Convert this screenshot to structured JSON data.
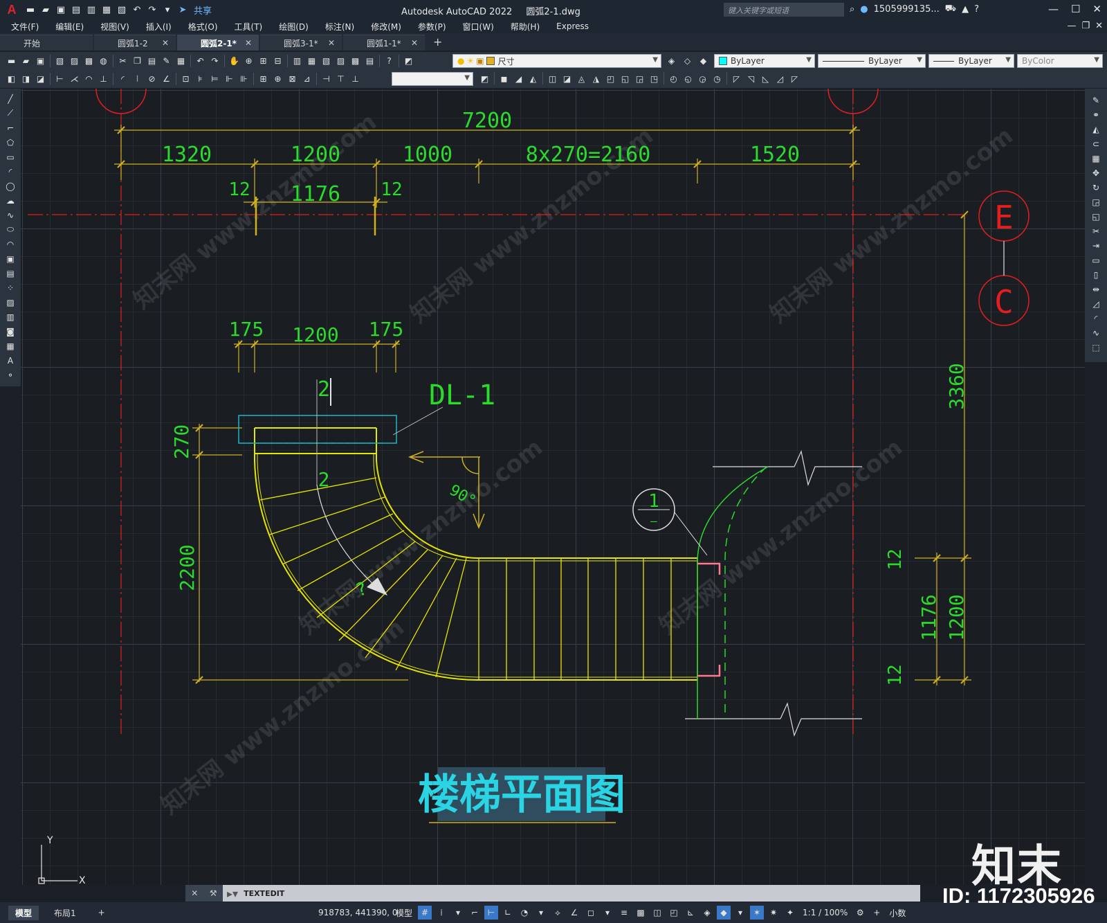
{
  "app": {
    "logo": "A",
    "title": "Autodesk AutoCAD 2022",
    "file": "圆弧2-1.dwg",
    "share": "共享",
    "search_placeholder": "键入关键字或短语",
    "user": "1505999135...",
    "help": "?"
  },
  "menu": [
    "文件(F)",
    "编辑(E)",
    "视图(V)",
    "插入(I)",
    "格式(O)",
    "工具(T)",
    "绘图(D)",
    "标注(N)",
    "修改(M)",
    "参数(P)",
    "窗口(W)",
    "帮助(H)",
    "Express"
  ],
  "tabs": [
    {
      "label": "开始",
      "active": false,
      "closable": false
    },
    {
      "label": "圆弧1-2",
      "active": false,
      "closable": true
    },
    {
      "label": "圆弧2-1*",
      "active": true,
      "closable": true
    },
    {
      "label": "圆弧3-1*",
      "active": false,
      "closable": true
    },
    {
      "label": "圆弧1-1*",
      "active": false,
      "closable": true
    }
  ],
  "properties": {
    "layer": "尺寸",
    "color": "ByLayer",
    "color_swatch": "#00ffff",
    "linetype": "ByLayer",
    "lineweight": "ByLayer",
    "plotstyle": "ByColor",
    "layer_swatch": "#e0b020"
  },
  "drawing": {
    "title": "楼梯平面图",
    "dims": {
      "total": "7200",
      "d1": "1320",
      "d2": "1200",
      "d3": "1000",
      "d4": "8x270=2160",
      "d5": "1520",
      "small_left": "12",
      "small_mid": "1176",
      "small_right": "12",
      "top_left": "175",
      "top_mid": "1200",
      "top_right": "175",
      "v270": "270",
      "v2200": "2200",
      "v3360": "3360",
      "r12a": "12",
      "r1176": "1176",
      "r1200": "1200",
      "r12b": "12"
    },
    "labels": {
      "beam": "DL-1",
      "section": "2",
      "section2": "2",
      "angle": "90°",
      "question": "?",
      "detail_num": "1",
      "detail_den": "—",
      "axis_e": "E",
      "axis_c": "C"
    },
    "ucs_y": "Y",
    "ucs_x": "X"
  },
  "command": {
    "text": "TEXTEDIT"
  },
  "status": {
    "layout_tabs": [
      "模型",
      "布局1"
    ],
    "coords": "918783, 441390, 0",
    "mode": "模型",
    "scale": "1:1 / 100%",
    "units": "小数"
  },
  "watermark": {
    "brand": "知末",
    "id": "ID: 1172305926",
    "tiles": [
      "知末网 www.znzmo.com",
      "知末网 www.znzmo.com",
      "知末网 www.znzmo.com",
      "知末网 www.znzmo.com",
      "知末网 www.znzmo.com",
      "知末网 www.znzmo.com"
    ]
  },
  "colors": {
    "dim_yellow": "#d1b21f",
    "dim_text_green": "#2bdb2b",
    "axis_red": "#e31e1e",
    "stair_yellow": "#e6e600",
    "beam_cyan": "#1cb8c8",
    "title_cyan": "#2ad4e2"
  }
}
